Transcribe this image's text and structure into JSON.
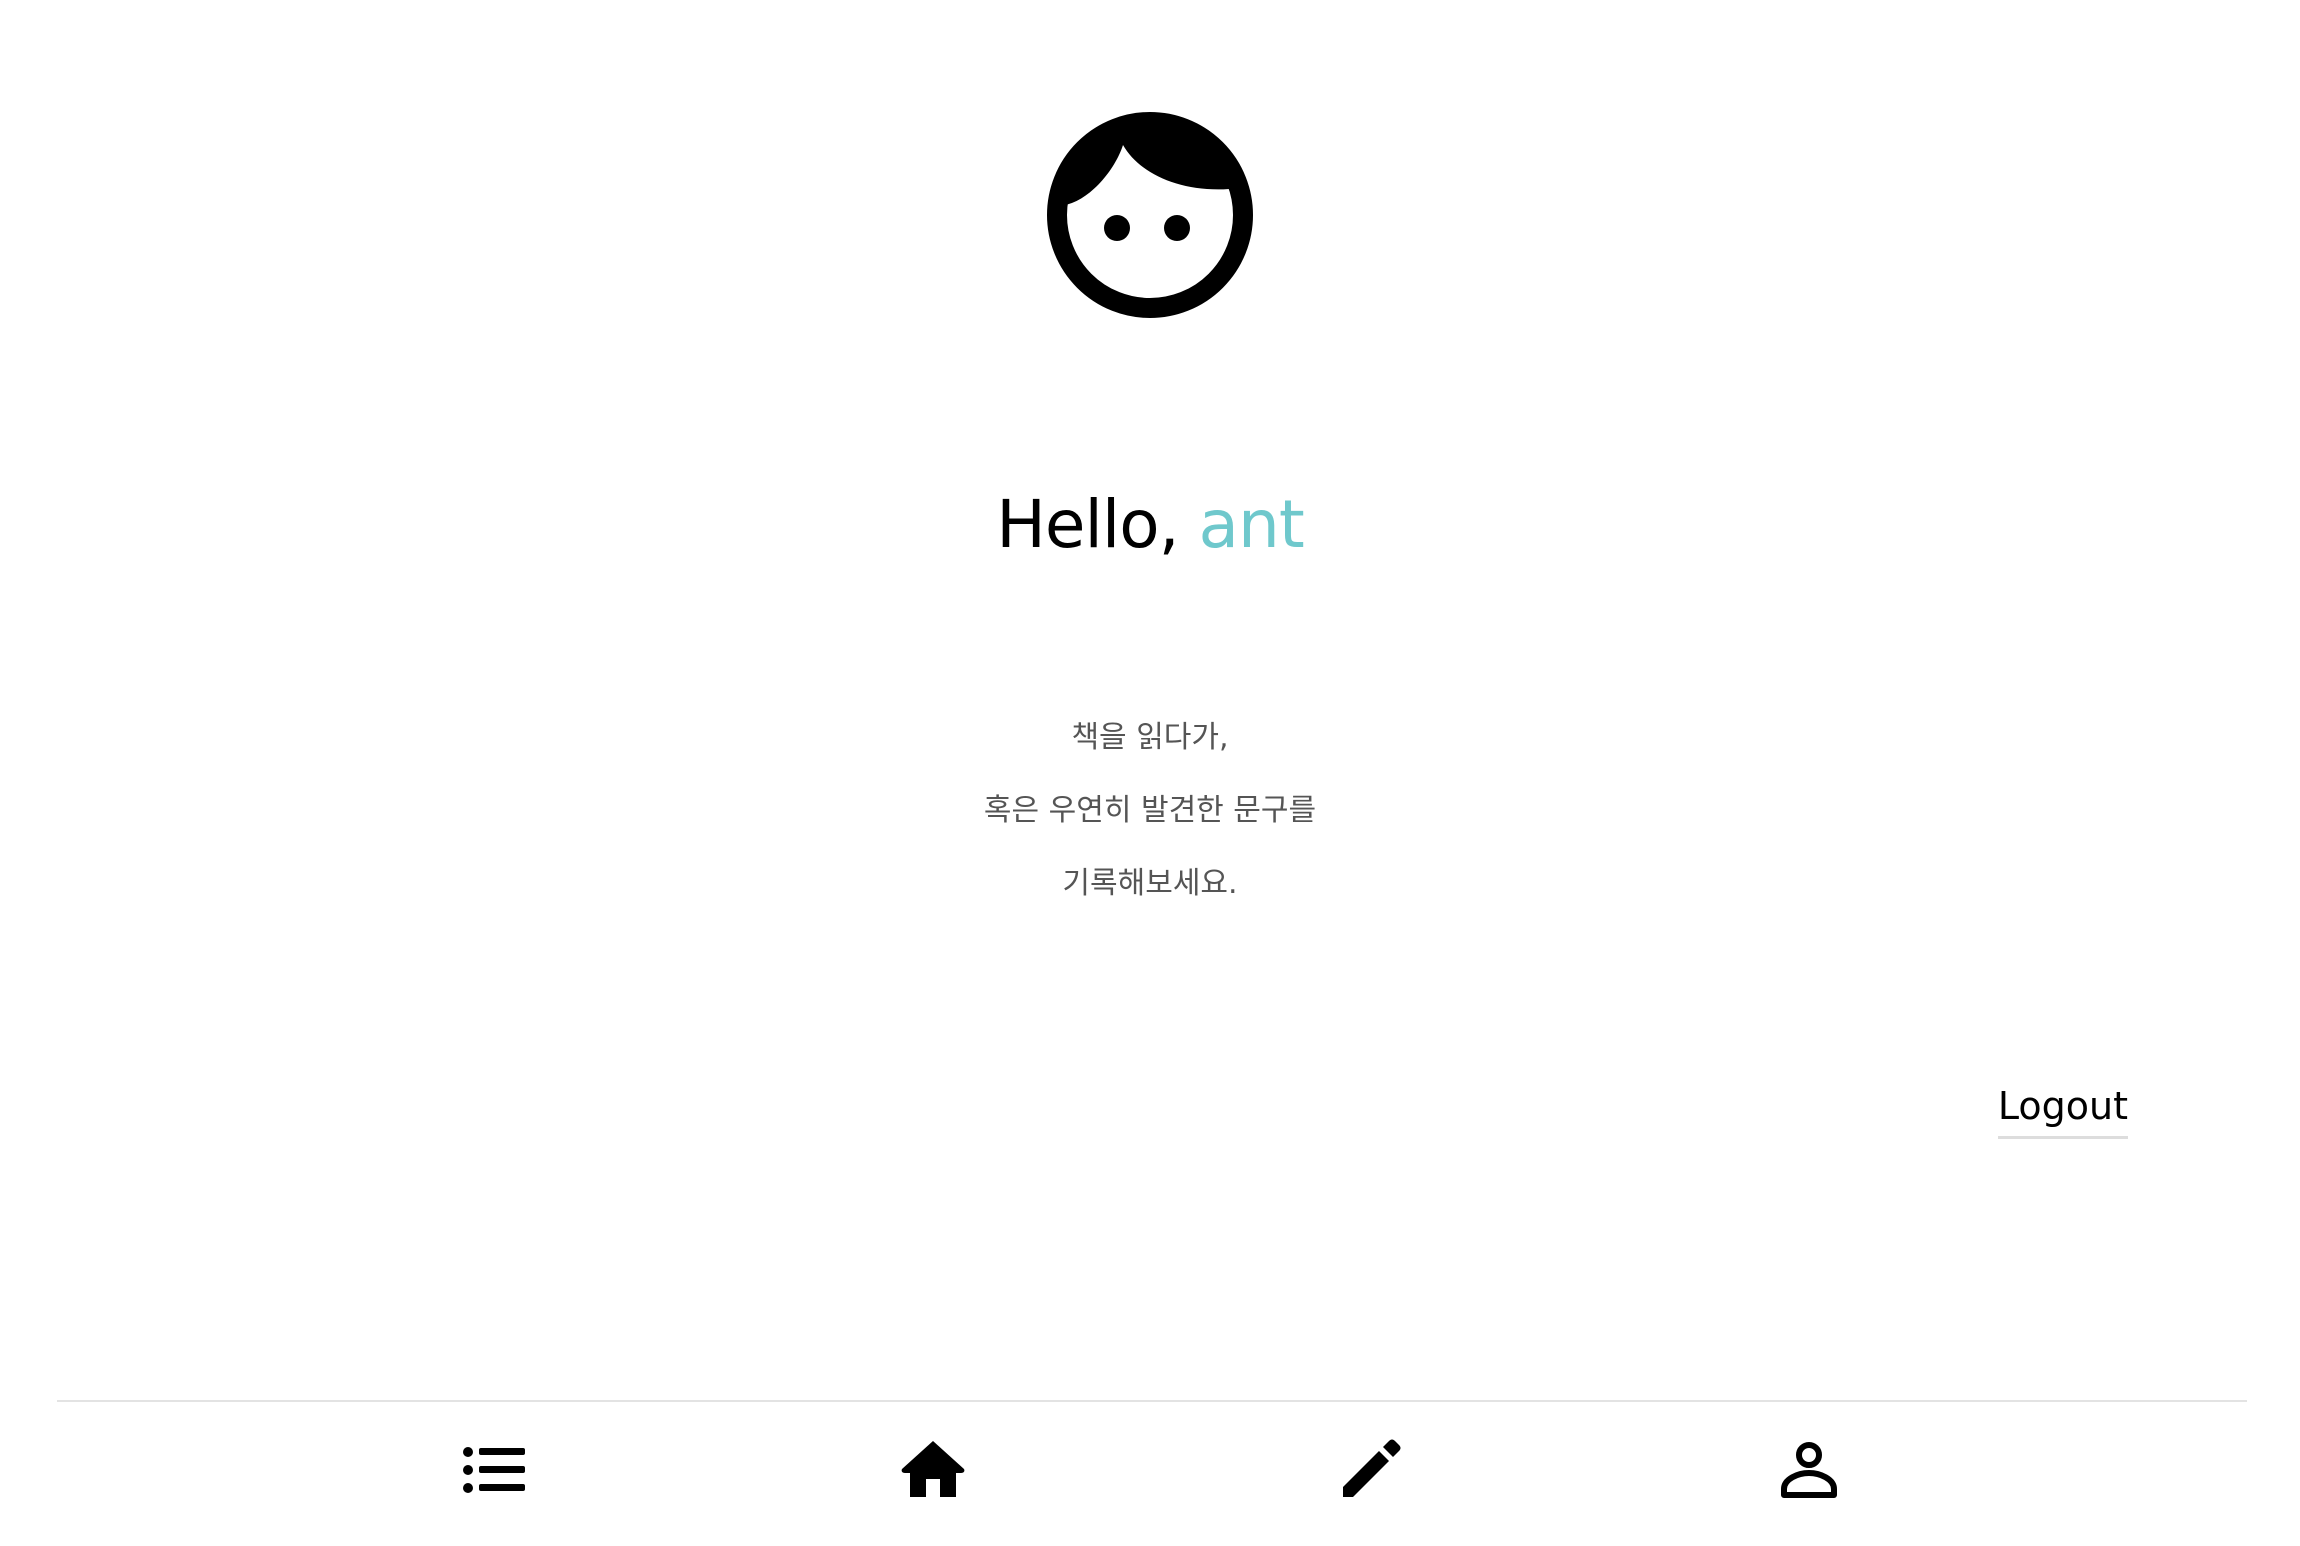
{
  "profile": {
    "avatar_icon": "child-face-icon"
  },
  "greeting": {
    "prefix": "Hello, ",
    "username": "ant",
    "accent_color": "#6fc8cc"
  },
  "message": {
    "lines": [
      "책을 읽다가,",
      "혹은 우연히 발견한 문구를",
      "기록해보세요."
    ]
  },
  "logout": {
    "label": "Logout"
  },
  "bottom_nav": {
    "items": [
      {
        "icon": "list-icon"
      },
      {
        "icon": "home-icon"
      },
      {
        "icon": "pencil-icon"
      },
      {
        "icon": "person-icon"
      }
    ]
  }
}
